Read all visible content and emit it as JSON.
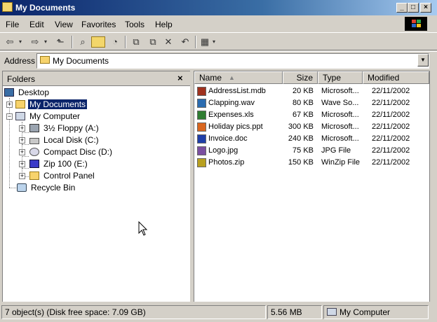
{
  "window": {
    "title": "My Documents"
  },
  "menu": [
    "File",
    "Edit",
    "View",
    "Favorites",
    "Tools",
    "Help"
  ],
  "address": {
    "label": "Address",
    "value": "My Documents"
  },
  "folders": {
    "title": "Folders",
    "close": "×",
    "tree": [
      {
        "label": "Desktop",
        "icon": "desktop-icon"
      },
      {
        "label": "My Documents",
        "icon": "folder-icon",
        "selected": true
      },
      {
        "label": "My Computer",
        "icon": "computer-icon"
      },
      {
        "label": "3½ Floppy (A:)",
        "icon": "floppy-icon"
      },
      {
        "label": "Local Disk (C:)",
        "icon": "disk-icon"
      },
      {
        "label": "Compact Disc (D:)",
        "icon": "cd-icon"
      },
      {
        "label": "Zip 100  (E:)",
        "icon": "zip-drive-icon"
      },
      {
        "label": "Control Panel",
        "icon": "control-panel-icon"
      },
      {
        "label": "Recycle Bin",
        "icon": "recycle-bin-icon"
      }
    ]
  },
  "list": {
    "columns": [
      "Name",
      "Size",
      "Type",
      "Modified"
    ],
    "rows": [
      {
        "name": "AddressList.mdb",
        "size": "20 KB",
        "type": "Microsoft...",
        "modified": "22/11/2002",
        "color": "#a0321e"
      },
      {
        "name": "Clapping.wav",
        "size": "80 KB",
        "type": "Wave So...",
        "modified": "22/11/2002",
        "color": "#2b6cb0"
      },
      {
        "name": "Expenses.xls",
        "size": "67 KB",
        "type": "Microsoft...",
        "modified": "22/11/2002",
        "color": "#2f7d32"
      },
      {
        "name": "Holiday pics.ppt",
        "size": "300 KB",
        "type": "Microsoft...",
        "modified": "22/11/2002",
        "color": "#d9661f"
      },
      {
        "name": "Invoice.doc",
        "size": "240 KB",
        "type": "Microsoft...",
        "modified": "22/11/2002",
        "color": "#1f3fa8"
      },
      {
        "name": "Logo.jpg",
        "size": "75 KB",
        "type": "JPG File",
        "modified": "22/11/2002",
        "color": "#7b4fa0"
      },
      {
        "name": "Photos.zip",
        "size": "150 KB",
        "type": "WinZip File",
        "modified": "22/11/2002",
        "color": "#b8a020"
      }
    ]
  },
  "status": {
    "objects": "7 object(s) (Disk free space: 7.09 GB)",
    "size": "5.56 MB",
    "location": "My Computer"
  }
}
